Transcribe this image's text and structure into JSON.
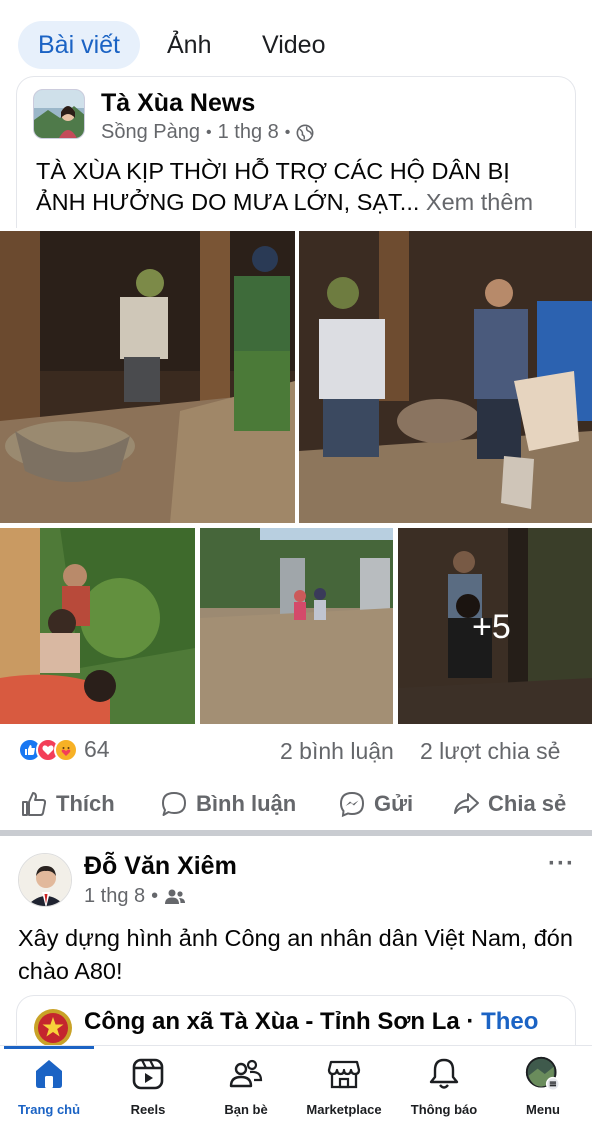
{
  "tabs": [
    {
      "label": "Bài viết",
      "active": true
    },
    {
      "label": "Ảnh",
      "active": false
    },
    {
      "label": "Video",
      "active": false
    }
  ],
  "post1": {
    "author": "Tà Xùa News",
    "location": "Sồng Pàng",
    "date": "1 thg 8",
    "privacy_icon": "globe-icon",
    "text_line1": "TÀ XÙA KỊP THỜI HỖ TRỢ CÁC HỘ DÂN BỊ",
    "text_line2": "ẢNH HƯỞNG DO MƯA LỚN, SẠT...",
    "see_more": "Xem thêm",
    "extra_photos": "+5",
    "reactions_count": "64",
    "reaction_icons": [
      "like-icon",
      "love-icon",
      "care-icon"
    ],
    "comments": "2 bình luận",
    "shares": "2 lượt chia sẻ"
  },
  "actions": {
    "like": "Thích",
    "comment": "Bình luận",
    "send": "Gửi",
    "share": "Chia sẻ"
  },
  "post2": {
    "author": "Đỗ Văn Xiêm",
    "date": "1 thg 8",
    "privacy_icon": "friends-icon",
    "text": "Xây dựng hình ảnh Công an nhân dân Việt Nam, đón chào A80!",
    "shared_page": "Công an xã Tà Xùa - Tỉnh Sơn La · ",
    "follow": "Theo",
    "menu": "···"
  },
  "bottom_nav": [
    {
      "label": "Trang chủ",
      "icon": "home-icon",
      "active": true
    },
    {
      "label": "Reels",
      "icon": "reels-icon",
      "active": false
    },
    {
      "label": "Bạn bè",
      "icon": "friends-icon",
      "active": false
    },
    {
      "label": "Marketplace",
      "icon": "marketplace-icon",
      "active": false
    },
    {
      "label": "Thông báo",
      "icon": "bell-icon",
      "active": false
    },
    {
      "label": "Menu",
      "icon": "profile-menu-icon",
      "active": false
    }
  ],
  "colors": {
    "accent": "#1b63c4",
    "tab_active_bg": "#e7f0fb",
    "secondary_text": "#65676b",
    "like_blue": "#1877f2",
    "love_red": "#f33e58",
    "care_yellow": "#f7b125"
  }
}
